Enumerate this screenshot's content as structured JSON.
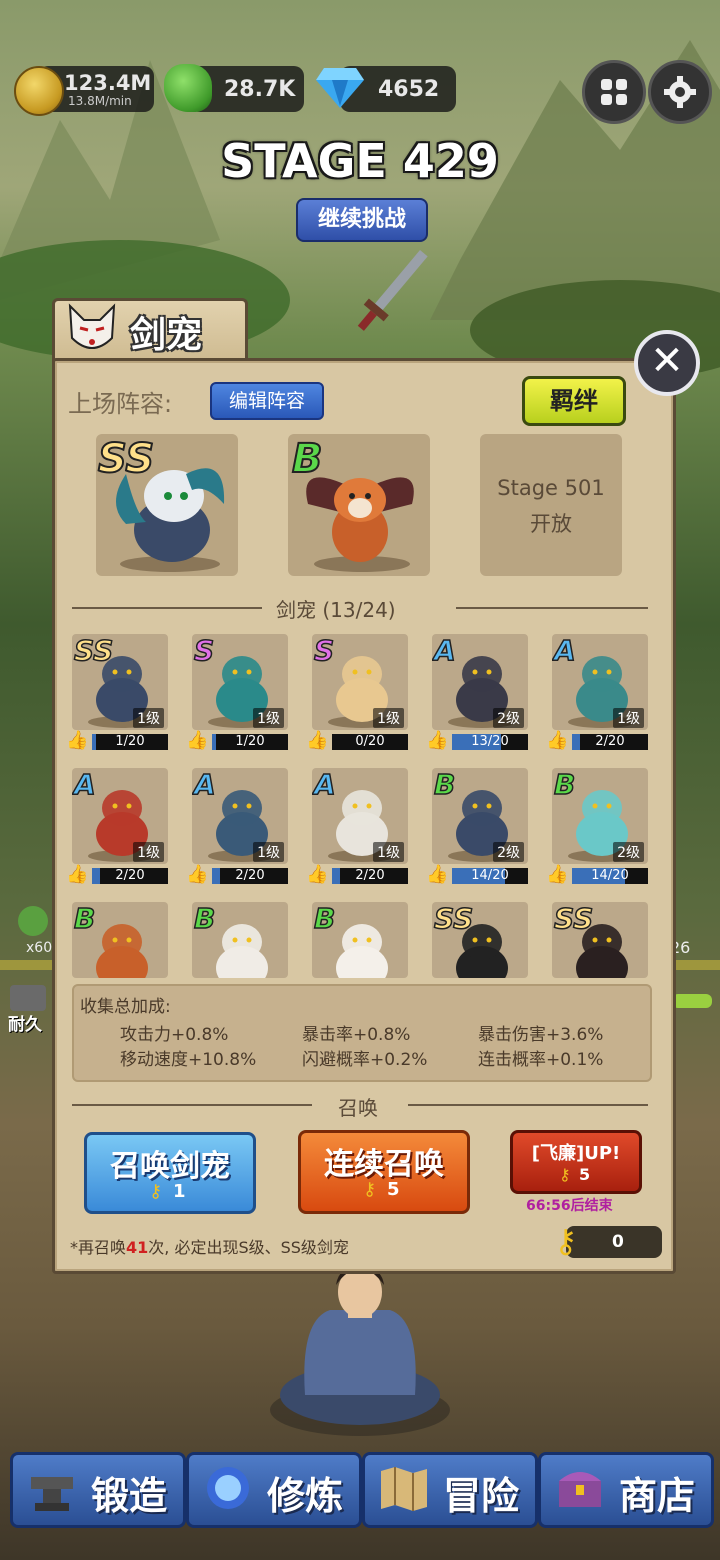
{
  "top_bar": {
    "coins": "123.4M",
    "coins_rate": "13.8M/min",
    "jade": "28.7K",
    "gems": "4652"
  },
  "stage": {
    "title": "STAGE 429",
    "continue_label": "继续挑战"
  },
  "panel": {
    "title": "剑宠",
    "lineup_label": "上场阵容:",
    "edit_lineup_label": "编辑阵容",
    "bond_label": "羁绊",
    "lineup": [
      {
        "grade": "SS",
        "grade_color": "#ffe08a"
      },
      {
        "grade": "B",
        "grade_color": "#5bd84a"
      },
      {
        "locked_text_1": "Stage 501",
        "locked_text_2": "开放"
      }
    ],
    "collection_header": "剑宠 (13/24)",
    "pets": [
      {
        "grade": "SS",
        "level": "1级",
        "progress": "1/20",
        "fill": 0.05,
        "color": "#ffe08a"
      },
      {
        "grade": "S",
        "level": "1级",
        "progress": "1/20",
        "fill": 0.05,
        "color": "#e070e8"
      },
      {
        "grade": "S",
        "level": "1级",
        "progress": "0/20",
        "fill": 0.0,
        "color": "#e070e8"
      },
      {
        "grade": "A",
        "level": "2级",
        "progress": "13/20",
        "fill": 0.65,
        "color": "#5ab8f0"
      },
      {
        "grade": "A",
        "level": "1级",
        "progress": "2/20",
        "fill": 0.1,
        "color": "#5ab8f0"
      },
      {
        "grade": "A",
        "level": "1级",
        "progress": "2/20",
        "fill": 0.1,
        "color": "#5ab8f0"
      },
      {
        "grade": "A",
        "level": "1级",
        "progress": "2/20",
        "fill": 0.1,
        "color": "#5ab8f0"
      },
      {
        "grade": "A",
        "level": "1级",
        "progress": "2/20",
        "fill": 0.1,
        "color": "#5ab8f0"
      },
      {
        "grade": "B",
        "level": "2级",
        "progress": "14/20",
        "fill": 0.7,
        "color": "#5bd84a"
      },
      {
        "grade": "B",
        "level": "2级",
        "progress": "14/20",
        "fill": 0.7,
        "color": "#5bd84a"
      },
      {
        "grade": "B",
        "color": "#5bd84a"
      },
      {
        "grade": "B",
        "color": "#5bd84a"
      },
      {
        "grade": "B",
        "color": "#5bd84a"
      },
      {
        "grade": "SS",
        "color": "#ffe08a"
      },
      {
        "grade": "SS",
        "color": "#ffe08a"
      }
    ],
    "bonus_title": "收集总加成:",
    "bonuses": [
      "攻击力+0.8%",
      "暴击率+0.8%",
      "暴击伤害+3.6%",
      "移动速度+10.8%",
      "闪避概率+0.2%",
      "连击概率+0.1%"
    ],
    "summon_header": "召唤",
    "summon_pet_label": "召唤剑宠",
    "summon_pet_cost": "1",
    "summon_multi_label": "连续召唤",
    "summon_multi_cost": "5",
    "event_label": "[飞廉]UP!",
    "event_cost": "5",
    "event_timer": "66:56后结束",
    "pity_prefix": "*再召唤",
    "pity_count": "41",
    "pity_suffix": "次, 必定出现S级、SS级剑宠",
    "keys": "0"
  },
  "nav": {
    "forge": "锻造",
    "cultivate": "修炼",
    "adventure": "冒险",
    "shop": "商店"
  },
  "side": {
    "left_label": "耐久",
    "left_count": "x60",
    "right_count": "26"
  }
}
